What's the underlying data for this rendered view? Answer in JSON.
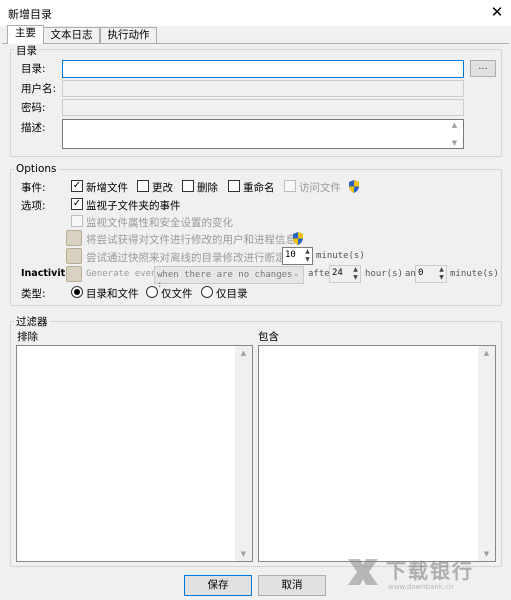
{
  "window": {
    "title": "新增目录",
    "close_glyph": "✕"
  },
  "tabs": [
    {
      "label": "主要"
    },
    {
      "label": "文本日志"
    },
    {
      "label": "执行动作"
    }
  ],
  "dir_group": {
    "legend": "目录",
    "directory_label": "目录:",
    "directory_value": "",
    "browse_label": "...",
    "username_label": "用户名:",
    "password_label": "密码:",
    "description_label": "描述:"
  },
  "options": {
    "legend": "Options",
    "events_label": "事件:",
    "events": [
      {
        "label": "新增文件",
        "checked": true,
        "enabled": true
      },
      {
        "label": "更改",
        "checked": false,
        "enabled": true
      },
      {
        "label": "删除",
        "checked": false,
        "enabled": true
      },
      {
        "label": "重命名",
        "checked": false,
        "enabled": true
      },
      {
        "label": "访问文件",
        "checked": false,
        "enabled": false
      }
    ],
    "options_label": "选项:",
    "watch_subfolders": {
      "label": "监视子文件夹的事件",
      "checked": true
    },
    "watch_attributes": {
      "label": "监视文件属性和安全设置的变化",
      "checked": false
    },
    "try_get_user": {
      "label": "将尝试获得对文件进行修改的用户和进程信息",
      "checked": false
    },
    "snapshot": {
      "label": "尝试通过快照来对离线的目录修改进行断定",
      "value": "10",
      "unit": "minute(s)"
    },
    "inactivity": {
      "label": "Inactivit",
      "generate_label": "Generate event",
      "select_value": "when there are no changes :",
      "after_label": "afte",
      "hours_value": "24",
      "hours_unit": "hour(s)",
      "and_label": "an",
      "minutes_value": "0",
      "minutes_unit": "minute(s)"
    },
    "type_label": "类型:",
    "types": [
      {
        "label": "目录和文件",
        "selected": true
      },
      {
        "label": "仅文件",
        "selected": false
      },
      {
        "label": "仅目录",
        "selected": false
      }
    ]
  },
  "filters": {
    "legend": "过滤器",
    "exclude_label": "排除",
    "include_label": "包含"
  },
  "footer": {
    "save_label": "保存",
    "cancel_label": "取消"
  },
  "watermark": {
    "brand": "下载银行",
    "url": "www.downbank.cn"
  },
  "colors": {
    "accent": "#0078d7",
    "shield_yellow": "#f2c200",
    "shield_blue": "#2a63c6"
  }
}
